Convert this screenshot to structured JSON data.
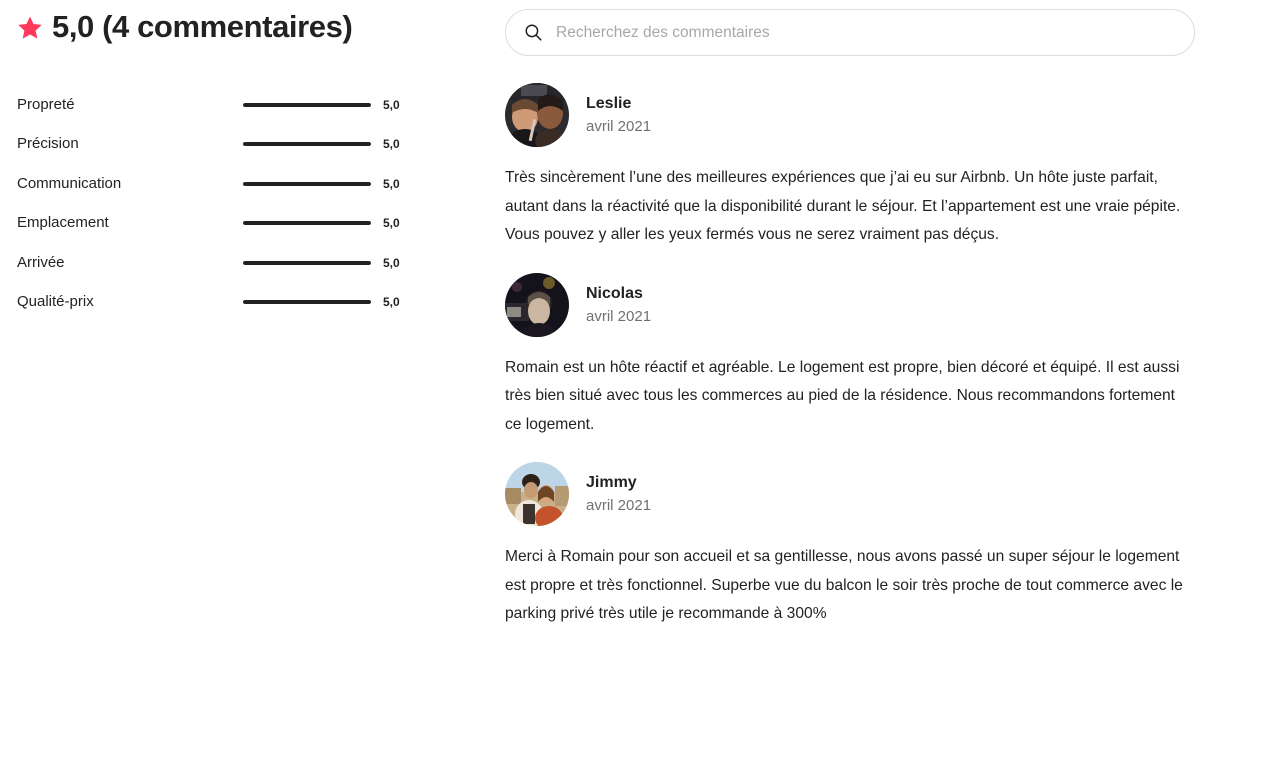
{
  "summary": {
    "star_icon": "star-icon",
    "rating": "5,0",
    "heading": "5,0 (4 commentaires)",
    "star_color": "#FF385C",
    "bar_fill_color": "#222222",
    "bar_track_color": "#DDDDDD",
    "categories": [
      {
        "label": "Propreté",
        "value": "5,0",
        "percent": 100
      },
      {
        "label": "Précision",
        "value": "5,0",
        "percent": 100
      },
      {
        "label": "Communication",
        "value": "5,0",
        "percent": 100
      },
      {
        "label": "Emplacement",
        "value": "5,0",
        "percent": 100
      },
      {
        "label": "Arrivée",
        "value": "5,0",
        "percent": 100
      },
      {
        "label": "Qualité-prix",
        "value": "5,0",
        "percent": 100
      }
    ]
  },
  "search": {
    "icon": "search-icon",
    "placeholder": "Recherchez des commentaires",
    "value": ""
  },
  "reviews": [
    {
      "name": "Leslie",
      "date": "avril 2021",
      "avatar": "avatar-leslie",
      "text": "Très sincèrement l’une des meilleures expériences que j’ai eu sur Airbnb. Un hôte juste parfait, autant dans la réactivité que la disponibilité durant le séjour. Et l’appartement est une vraie pépite. Vous pouvez y aller les yeux fermés vous ne serez vraiment pas déçus."
    },
    {
      "name": "Nicolas",
      "date": "avril 2021",
      "avatar": "avatar-nicolas",
      "text": "Romain est un hôte réactif et agréable. Le logement est propre, bien décoré et équipé. Il est aussi très bien situé avec tous les commerces au pied de la résidence. Nous recommandons fortement ce logement."
    },
    {
      "name": "Jimmy",
      "date": "avril 2021",
      "avatar": "avatar-jimmy",
      "text": "Merci à Romain pour son accueil et sa gentillesse, nous avons passé un super séjour le logement est propre et très fonctionnel. Superbe vue du balcon le soir très proche de tout commerce avec le parking privé très utile je recommande à 300%"
    }
  ]
}
